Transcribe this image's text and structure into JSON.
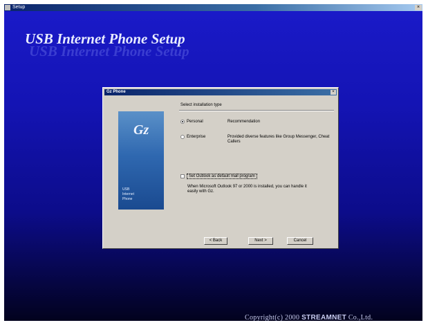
{
  "window": {
    "title": "Setup",
    "close": "×"
  },
  "header": {
    "title": "USB Internet Phone Setup",
    "reflection": "USB Internet Phone Setup"
  },
  "footer": {
    "copyright_prefix": "Copyright(c) 2000",
    "company": "STREAMNET",
    "suffix": "Co.,Ltd."
  },
  "dialog": {
    "title": "Gz Phone",
    "close": "×",
    "side_panel": {
      "logo": "Gz",
      "lines": [
        "USB",
        "Internet",
        "Phone"
      ]
    },
    "section_title": "Select installation type",
    "options": [
      {
        "label": "Personal",
        "description": "Recommendation",
        "selected": true
      },
      {
        "label": "Enterprise",
        "description": "Provided diverse features like Group Messenger, Cheat Callers",
        "selected": false
      }
    ],
    "checkbox": {
      "label": "Set Outlook as default mail program",
      "checked": false
    },
    "note": "When Microsoft Outlook 97 or 2000 is installed, you can handle it easily with Gz.",
    "buttons": {
      "back": "< Back",
      "next": "Next >",
      "cancel": "Cancel"
    }
  },
  "colors": {
    "background_top": "#1a1ac8",
    "background_bottom": "#02021e",
    "dialog_face": "#d4d0c8",
    "titlebar": "#0a246a"
  }
}
